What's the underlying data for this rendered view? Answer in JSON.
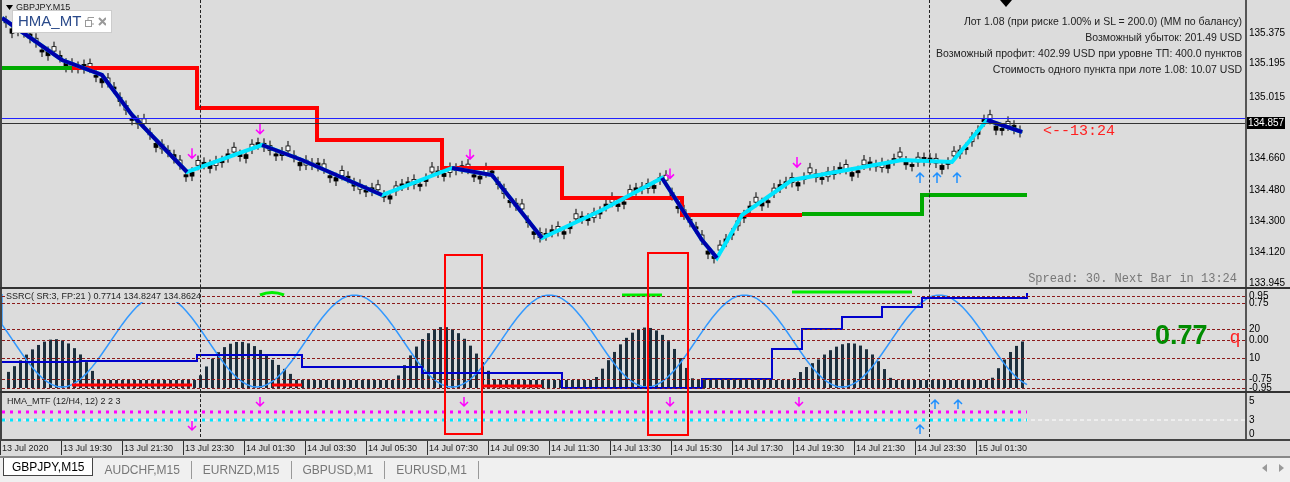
{
  "chart": {
    "symbol": "GBPJPY,M15",
    "indicator_window": {
      "title": "HMA_MT"
    },
    "info_lines": [
      "Лот 1.08 (при риске 1.00% и SL = 200.0) (ММ по балансу)",
      "Возможный убыток: 201.49 USD",
      "Возможный профит: 402.99 USD при уровне ТП: 400.0 пунктов",
      "Стоимость одного пункта при лоте 1.08: 10.07 USD"
    ],
    "price_labels": [
      "135.375",
      "135.195",
      "135.015",
      "134.660",
      "134.480",
      "134.300",
      "134.120",
      "133.945"
    ],
    "current_price": "134.857",
    "timer": "<--13:24",
    "spread": "Spread: 30. Next Bar in 13:24"
  },
  "ssrc": {
    "label": "SSRC( SR:3, FP:21 ) 0.7714 134.8247 134.8624",
    "value": "0.77",
    "mark": "q",
    "scale": [
      "0.95",
      "0.75",
      "20",
      "0.00",
      "10",
      "-0.75",
      "-0.95"
    ]
  },
  "hma": {
    "label": "HMA_MTF (12/H4, 12) 2 2 3",
    "scale": [
      "5",
      "3",
      "0"
    ]
  },
  "time_axis": [
    "13 Jul 2020",
    "13 Jul 19:30",
    "13 Jul 21:30",
    "13 Jul 23:30",
    "14 Jul 01:30",
    "14 Jul 03:30",
    "14 Jul 05:30",
    "14 Jul 07:30",
    "14 Jul 09:30",
    "14 Jul 11:30",
    "14 Jul 13:30",
    "14 Jul 15:30",
    "14 Jul 17:30",
    "14 Jul 19:30",
    "14 Jul 21:30",
    "14 Jul 23:30",
    "15 Jul 01:30"
  ],
  "tabs": [
    {
      "label": "GBPJPY,M15",
      "selected": true
    },
    {
      "label": "AUDCHF,M15",
      "selected": false
    },
    {
      "label": "EURNZD,M15",
      "selected": false
    },
    {
      "label": "GBPUSD,M1",
      "selected": false
    },
    {
      "label": "EURUSD,M1",
      "selected": false
    }
  ]
}
